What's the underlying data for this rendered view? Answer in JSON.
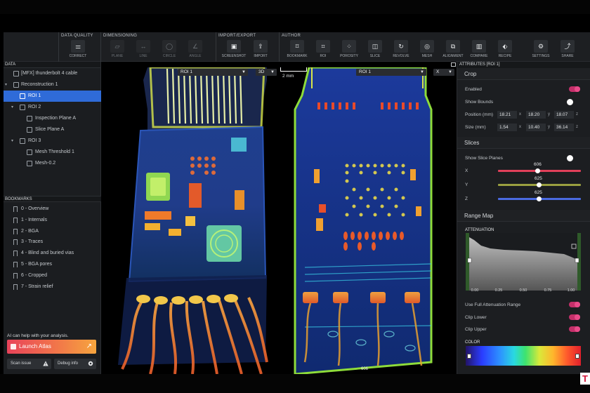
{
  "toolbar": {
    "groups": [
      {
        "title": "DATA QUALITY",
        "buttons": [
          {
            "label": "CORRECT",
            "icon": "sliders-icon"
          }
        ]
      },
      {
        "title": "DIMENSIONING",
        "buttons": [
          {
            "label": "PLANE",
            "icon": "plane-icon"
          },
          {
            "label": "LINE",
            "icon": "line-icon"
          },
          {
            "label": "CIRCLE",
            "icon": "circle-icon"
          },
          {
            "label": "ANGLE",
            "icon": "angle-icon"
          }
        ]
      },
      {
        "title": "IMPORT/EXPORT",
        "buttons": [
          {
            "label": "SCREENSHOT",
            "icon": "camera-icon"
          },
          {
            "label": "IMPORT",
            "icon": "upload-icon"
          }
        ]
      },
      {
        "title": "AUTHOR",
        "buttons": [
          {
            "label": "BOOKMARK",
            "icon": "bookmark-icon"
          },
          {
            "label": "ROI",
            "icon": "crop-icon"
          },
          {
            "label": "POROSITY",
            "icon": "dots-icon"
          },
          {
            "label": "SLICE",
            "icon": "slice-icon"
          },
          {
            "label": "REVOLVE",
            "icon": "revolve-icon"
          },
          {
            "label": "MESH",
            "icon": "mesh-icon"
          },
          {
            "label": "ALIGNMENT",
            "icon": "align-icon"
          },
          {
            "label": "COMPARE",
            "icon": "bars-icon"
          },
          {
            "label": "RECIPE",
            "icon": "recipe-icon"
          }
        ]
      }
    ],
    "right_buttons": [
      {
        "label": "SETTINGS",
        "icon": "gear-icon"
      },
      {
        "label": "SHARE",
        "icon": "share-icon"
      }
    ]
  },
  "left": {
    "data_header": "DATA",
    "tree": [
      {
        "label": "[MFX] thunderbolt 4 cable",
        "indent": 0,
        "caret": "",
        "selected": false
      },
      {
        "label": "Reconstruction 1",
        "indent": 0,
        "caret": "▾",
        "selected": false
      },
      {
        "label": "ROI 1",
        "indent": 1,
        "caret": "",
        "selected": true
      },
      {
        "label": "ROI 2",
        "indent": 1,
        "caret": "▾",
        "selected": false
      },
      {
        "label": "Inspection Plane A",
        "indent": 2,
        "caret": "",
        "selected": false
      },
      {
        "label": "Slice Plane A",
        "indent": 2,
        "caret": "",
        "selected": false
      },
      {
        "label": "ROI 3",
        "indent": 1,
        "caret": "▾",
        "selected": false
      },
      {
        "label": "Mesh Threshold 1",
        "indent": 2,
        "caret": "",
        "selected": false
      },
      {
        "label": "Mesh-0.2",
        "indent": 2,
        "caret": "",
        "selected": false
      }
    ],
    "bookmarks_header": "BOOKMARKS",
    "bookmarks": [
      "0 - Overview",
      "1 - Internals",
      "2 - BGA",
      "3 - Traces",
      "4 - Blind and buried vias",
      "5 - BGA pores",
      "6 - Cropped",
      "7 - Strain relief"
    ],
    "ai_text": "AI can help with your analysis.",
    "atlas_label": "Launch Atlas",
    "scan_issue": "Scan issue",
    "debug_info": "Debug info"
  },
  "viewer": {
    "left_select": "ROI 1",
    "mode_select": "3D",
    "right_select": "ROI 1",
    "axis_select": "X",
    "scale": "2 mm",
    "slice_index": "606"
  },
  "right": {
    "header": "ATTRIBUTES [ROI 1]",
    "crop": {
      "title": "Crop",
      "enabled_label": "Enabled",
      "enabled": true,
      "show_bounds_label": "Show Bounds",
      "position_label": "Position (mm)",
      "position": [
        "18.21",
        "18.20",
        "18.07"
      ],
      "size_label": "Size (mm)",
      "size": [
        "1.54",
        "10.40",
        "36.14"
      ],
      "axes": [
        "x",
        "y",
        "z"
      ]
    },
    "slices": {
      "title": "Slices",
      "show_label": "Show Slice Planes",
      "sliders": [
        {
          "axis": "X",
          "value": "606",
          "color": "#e0405a",
          "level": 0.48
        },
        {
          "axis": "Y",
          "value": "625",
          "color": "#9aa040",
          "level": 0.5
        },
        {
          "axis": "Z",
          "value": "625",
          "color": "#4a6ae0",
          "level": 0.5
        }
      ]
    },
    "range_map": {
      "title": "Range Map",
      "attenuation_label": "ATTENUATION",
      "ticks": [
        "0.00",
        "0.25",
        "0.50",
        "0.75",
        "1.00"
      ],
      "use_full_label": "Use Full Attenuation Range",
      "clip_lower_label": "Clip Lower",
      "clip_upper_label": "Clip Upper",
      "color_label": "COLOR"
    },
    "accent": "#c4306a"
  }
}
